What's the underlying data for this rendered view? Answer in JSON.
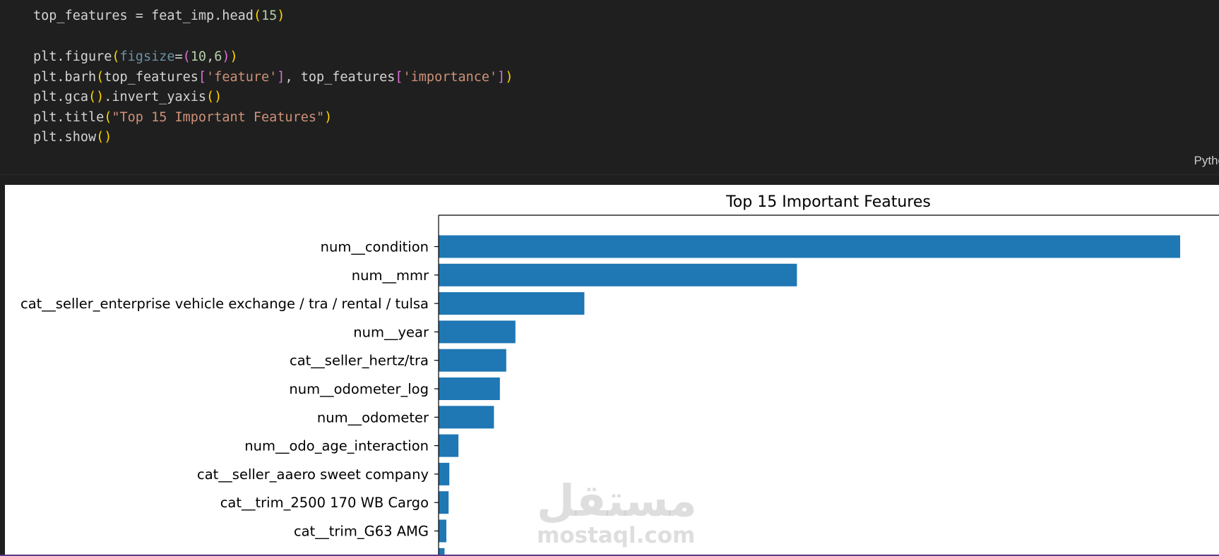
{
  "code": {
    "line1": {
      "a": "top_features = feat_imp.head",
      "b": "(",
      "c": "15",
      "d": ")"
    },
    "line3": {
      "a": "plt.figure",
      "b": "(",
      "c": "figsize",
      "d": "=",
      "e": "(",
      "f": "10",
      "g": ",",
      "h": "6",
      "i": ")",
      "j": ")"
    },
    "line4": {
      "a": "plt.barh",
      "b": "(",
      "c": "top_features",
      "d": "[",
      "e": "'feature'",
      "f": "]",
      "g": ", top_features",
      "h": "[",
      "i": "'importance'",
      "j": "]",
      "k": ")"
    },
    "line5": {
      "a": "plt.gca",
      "b": "()",
      "c": ".invert_yaxis",
      "d": "()"
    },
    "line6": {
      "a": "plt.title",
      "b": "(",
      "c": "\"Top 15 Important Features\"",
      "d": ")"
    },
    "line7": {
      "a": "plt.show",
      "b": "()"
    }
  },
  "cell": {
    "language_label": "Pytho"
  },
  "watermark": {
    "arabic": "مستقل",
    "latin": "mostaql.com"
  },
  "colors": {
    "bar": "#1f77b4",
    "background": "#1f1f1f"
  },
  "chart_data": {
    "type": "bar",
    "orientation": "horizontal",
    "title": "Top 15 Important Features",
    "categories": [
      "num__condition",
      "num__mmr",
      "cat__seller_enterprise vehicle exchange / tra / rental / tulsa",
      "num__year",
      "cat__seller_hertz/tra",
      "num__odometer_log",
      "num__odometer",
      "num__odo_age_interaction",
      "cat__seller_aaero sweet company",
      "cat__trim_2500 170 WB Cargo",
      "cat__trim_G63 AMG",
      ""
    ],
    "values": [
      1.0,
      0.4832,
      0.1966,
      0.1036,
      0.0912,
      0.0827,
      0.0747,
      0.0268,
      0.0145,
      0.0135,
      0.0105,
      0.008
    ],
    "grid": false,
    "legend": "none"
  }
}
